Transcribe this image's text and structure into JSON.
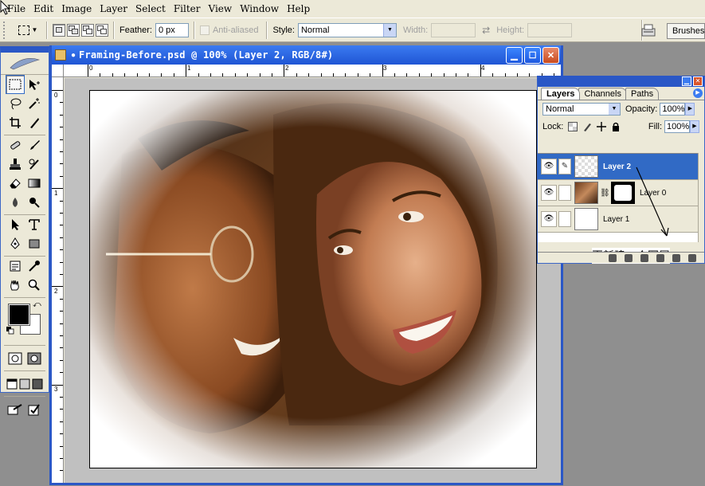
{
  "menu": [
    "File",
    "Edit",
    "Image",
    "Layer",
    "Select",
    "Filter",
    "View",
    "Window",
    "Help"
  ],
  "options": {
    "feather_label": "Feather:",
    "feather_value": "0 px",
    "antialias_label": "Anti-aliased",
    "style_label": "Style:",
    "style_value": "Normal",
    "width_label": "Width:",
    "height_label": "Height:",
    "brushes_tab": "Brushes"
  },
  "document": {
    "title": "Framing-Before.psd @ 100% (Layer 2, RGB/8#)",
    "ruler_top_labels": [
      "0",
      "1",
      "2",
      "3",
      "4"
    ],
    "ruler_left_labels": [
      "0",
      "1",
      "2",
      "3"
    ]
  },
  "layers_panel": {
    "tabs": [
      "Layers",
      "Channels",
      "Paths"
    ],
    "blend_mode": "Normal",
    "opacity_label": "Opacity:",
    "opacity_value": "100%",
    "lock_label": "Lock:",
    "fill_label": "Fill:",
    "fill_value": "100%",
    "layers": [
      {
        "name": "Layer 2",
        "thumb": "transparent",
        "active": true
      },
      {
        "name": "Layer 0",
        "thumb": "photo",
        "active": false
      },
      {
        "name": "Layer 1",
        "thumb": "white",
        "active": false
      }
    ],
    "annotation": "再新建一个图层"
  },
  "colors": {
    "foreground": "#000000",
    "background": "#ffffff",
    "accent": "#316ac5",
    "title_blue": "#2a57c6"
  }
}
